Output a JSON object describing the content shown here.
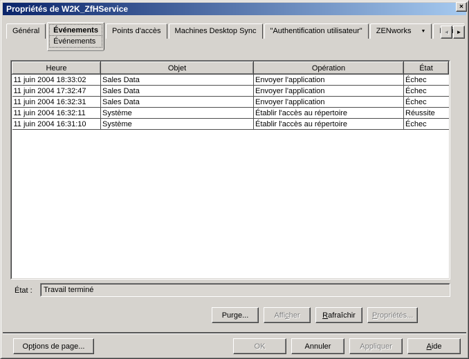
{
  "window": {
    "title": "Propriétés de W2K_ZfHService"
  },
  "icons": {
    "close": "✕",
    "tab_scroll_left": "◄",
    "tab_scroll_right": "►",
    "tab_dropdown": "▼"
  },
  "tabs": [
    {
      "label": "Général",
      "active": false
    },
    {
      "label": "Événements",
      "active": true,
      "sublabel": "Événements"
    },
    {
      "label": "Points d'accès",
      "active": false
    },
    {
      "label": "Machines Desktop Sync",
      "active": false
    },
    {
      "label": "\"Authentification utilisateur\"",
      "active": false
    },
    {
      "label": "ZENworks",
      "active": false,
      "dropdown": true
    },
    {
      "label": "Droits",
      "active": false,
      "clipped": true
    }
  ],
  "table": {
    "columns": [
      "Heure",
      "Objet",
      "Opération",
      "État"
    ],
    "rows": [
      [
        "11 juin 2004 18:33:02",
        "Sales Data",
        "Envoyer l'application",
        "Échec"
      ],
      [
        "11 juin 2004 17:32:47",
        "Sales Data",
        "Envoyer l'application",
        "Échec"
      ],
      [
        "11 juin 2004 16:32:31",
        "Sales Data",
        "Envoyer l'application",
        "Échec"
      ],
      [
        "11 juin 2004 16:32:11",
        "Système",
        "Établir l'accès au répertoire",
        "Réussite"
      ],
      [
        "11 juin 2004 16:31:10",
        "Système",
        "Établir l'accès au répertoire",
        "Échec"
      ]
    ]
  },
  "status": {
    "label": "État :",
    "value": "Travail terminé"
  },
  "action_buttons": [
    {
      "label": "Purge...",
      "underline": 3,
      "enabled": true
    },
    {
      "label": "Afficher",
      "underline": 4,
      "enabled": false
    },
    {
      "label": "Rafraîchir",
      "underline": 0,
      "enabled": true
    },
    {
      "label": "Propriétés...",
      "underline": 0,
      "enabled": false
    }
  ],
  "page_options_button": {
    "label": "Options de page...",
    "underline": 2,
    "enabled": true
  },
  "dialog_buttons": [
    {
      "label": "OK",
      "underline": -1,
      "enabled": false
    },
    {
      "label": "Annuler",
      "underline": -1,
      "enabled": true
    },
    {
      "label": "Appliquer",
      "underline": -1,
      "enabled": false
    },
    {
      "label": "Aide",
      "underline": 0,
      "enabled": true
    }
  ],
  "colors": {
    "titlebar_gradient_start": "#0a246a",
    "titlebar_gradient_end": "#a6caf0",
    "dialog_face": "#d6d3ce",
    "table_background": "#ffffff",
    "disabled_text": "#808080"
  }
}
